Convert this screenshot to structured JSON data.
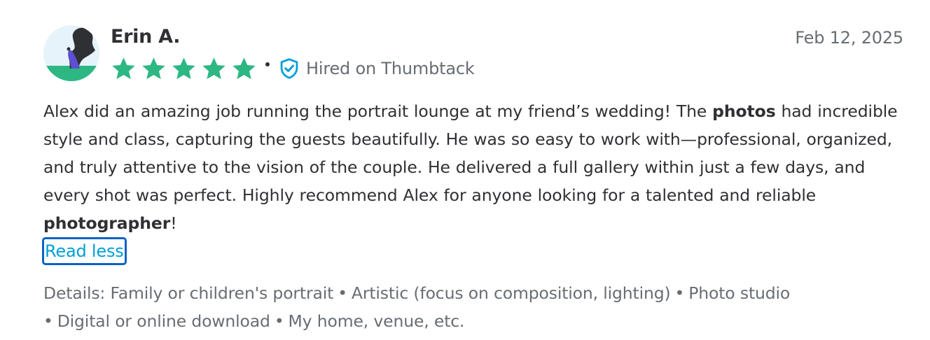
{
  "reviewer": {
    "name": "Erin A.",
    "avatar_icon": "person-silhouette-avatar-icon"
  },
  "date": "Feb 12, 2025",
  "rating": {
    "stars": 5,
    "max": 5,
    "star_color": "#2db783",
    "star_icon": "star-icon"
  },
  "badge": {
    "label": "Hired on Thumbtack",
    "icon": "shield-check-icon",
    "color": "#009fd9"
  },
  "review": {
    "segments": [
      {
        "text": "Alex did an amazing job running the portrait lounge at my friend’s wedding! The ",
        "bold": false
      },
      {
        "text": "photos",
        "bold": true
      },
      {
        "text": " had incredible style and class, capturing the guests beautifully. He was so easy to work with—professional, organized, and truly attentive to the vision of the couple. He delivered a full gallery within just a few days, and every shot was perfect. Highly recommend Alex for anyone looking for a talented and reliable ",
        "bold": false
      },
      {
        "text": "photographer",
        "bold": true
      },
      {
        "text": "!",
        "bold": false
      }
    ]
  },
  "read_less_label": "Read less",
  "details": {
    "prefix": "Details:",
    "items": [
      "Family or children's portrait",
      "Artistic (focus on composition, lighting)",
      "Photo studio",
      "Digital or online download",
      "My home, venue, etc."
    ]
  },
  "colors": {
    "text": "#2f3033",
    "muted": "#676d73",
    "link": "#009fd9",
    "focus_outline": "#0b63c5",
    "star": "#2db783"
  }
}
